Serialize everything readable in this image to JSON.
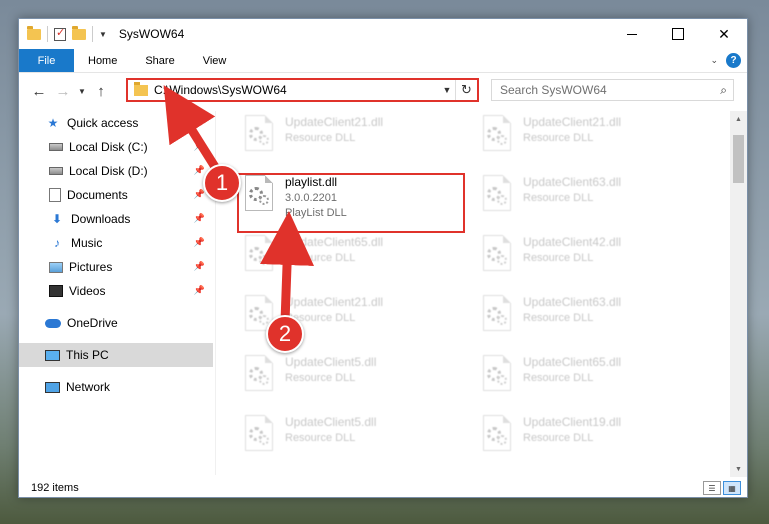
{
  "window": {
    "title": "SysWOW64"
  },
  "ribbon": {
    "tabs": [
      "File",
      "Home",
      "Share",
      "View"
    ],
    "help": "?"
  },
  "address": {
    "path": "C:\\Windows\\SysWOW64"
  },
  "search": {
    "placeholder": "Search SysWOW64"
  },
  "sidebar": {
    "items": [
      {
        "label": "Quick access",
        "icon": "star-icon",
        "pinned": false
      },
      {
        "label": "Local Disk (C:)",
        "icon": "disk-icon",
        "pinned": true
      },
      {
        "label": "Local Disk (D:)",
        "icon": "disk-icon",
        "pinned": true
      },
      {
        "label": "Documents",
        "icon": "document-icon",
        "pinned": true
      },
      {
        "label": "Downloads",
        "icon": "download-icon",
        "pinned": true
      },
      {
        "label": "Music",
        "icon": "music-icon",
        "pinned": true
      },
      {
        "label": "Pictures",
        "icon": "picture-icon",
        "pinned": true
      },
      {
        "label": "Videos",
        "icon": "video-icon",
        "pinned": true
      },
      {
        "label": "OneDrive",
        "icon": "cloud-icon"
      },
      {
        "label": "This PC",
        "icon": "computer-icon",
        "selected": true
      },
      {
        "label": "Network",
        "icon": "network-icon"
      }
    ]
  },
  "files": {
    "focus": {
      "name": "playlist.dll",
      "version": "3.0.0.2201",
      "description": "PlayList DLL"
    },
    "blurred": [
      {
        "name": "UpdateClient21.dll",
        "type": "Resource DLL"
      },
      {
        "name": "UpdateClient21.dll",
        "type": "Resource DLL"
      },
      {
        "name": "UpdateClient63.dll",
        "type": "Resource DLL"
      },
      {
        "name": "UpdateClient65.dll",
        "type": "Resource DLL"
      },
      {
        "name": "UpdateClient42.dll",
        "type": "Resource DLL"
      },
      {
        "name": "UpdateClient21.dll",
        "type": "Resource DLL"
      },
      {
        "name": "UpdateClient63.dll",
        "type": "Resource DLL"
      },
      {
        "name": "UpdateClient5.dll",
        "type": "Resource DLL"
      },
      {
        "name": "UpdateClient65.dll",
        "type": "Resource DLL"
      },
      {
        "name": "UpdateClient5.dll",
        "type": "Resource DLL"
      },
      {
        "name": "UpdateClient19.dll",
        "type": "Resource DLL"
      }
    ]
  },
  "status": {
    "count": "192 items"
  },
  "annotations": {
    "step1": "1",
    "step2": "2",
    "color": "#e0322b"
  }
}
